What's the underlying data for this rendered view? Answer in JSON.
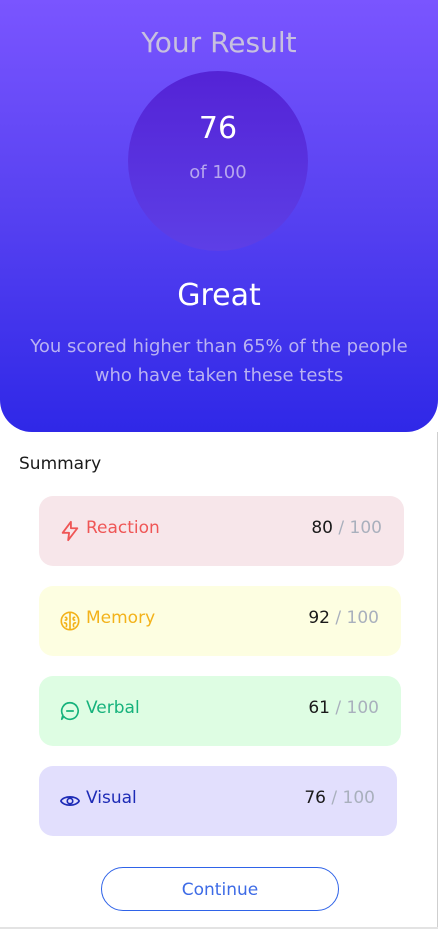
{
  "result": {
    "title": "Your Result",
    "score": "76",
    "of_label": "of 100",
    "label": "Great",
    "description": "You scored higher than 65% of the people who have taken these tests"
  },
  "summary": {
    "title": "Summary",
    "items": [
      {
        "label": "Reaction",
        "score": "80",
        "max": "/ 100",
        "icon": "lightning-icon",
        "bg": "#f7e6ea",
        "color": "#ef5656"
      },
      {
        "label": "Memory",
        "score": "92",
        "max": "/ 100",
        "icon": "brain-icon",
        "bg": "#fdfee1",
        "color": "#f3b21a"
      },
      {
        "label": "Verbal",
        "score": "61",
        "max": "/ 100",
        "icon": "chat-icon",
        "bg": "#defde3",
        "color": "#16b27c"
      },
      {
        "label": "Visual",
        "score": "76",
        "max": "/ 100",
        "icon": "eye-icon",
        "bg": "#e2dffd",
        "color": "#1d2bb6"
      }
    ]
  },
  "actions": {
    "continue_label": "Continue"
  }
}
